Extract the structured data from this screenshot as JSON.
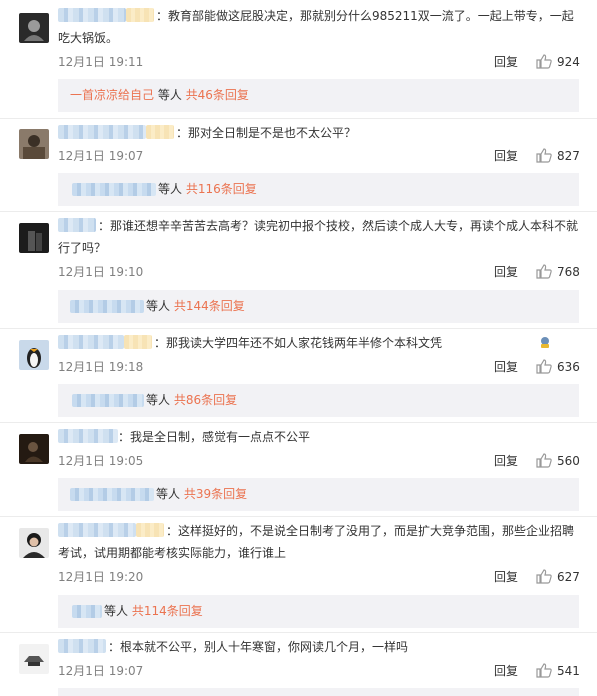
{
  "comments": [
    {
      "text": "：教育部能做这屁股决定，那就别分什么985211双一流了。一起上带专，一起吃大锅饭。",
      "date": "12月1日 19:11",
      "reply_label": "回复",
      "likes": "924",
      "sub_prefix": "一首凉凉给自己",
      "sub_mid": " 等人 ",
      "sub_count": "共46条回复"
    },
    {
      "text": "：那对全日制是不是也不太公平？",
      "date": "12月1日 19:07",
      "reply_label": "回复",
      "likes": "827",
      "sub_mid": "等人 ",
      "sub_count": "共116条回复"
    },
    {
      "text": "：那谁还想辛辛苦苦去高考？读完初中报个技校，然后读个成人大专，再读个成人本科不就行了吗？",
      "date": "12月1日 19:10",
      "reply_label": "回复",
      "likes": "768",
      "sub_mid": "等人 ",
      "sub_count": "共144条回复"
    },
    {
      "text": "：那我读大学四年还不如人家花钱两年半修个本科文凭",
      "date": "12月1日 19:18",
      "reply_label": "回复",
      "likes": "636",
      "sub_mid": "等人 ",
      "sub_count": "共86条回复"
    },
    {
      "text": "：我是全日制，感觉有一点点不公平",
      "date": "12月1日 19:05",
      "reply_label": "回复",
      "likes": "560",
      "sub_mid": "等人 ",
      "sub_count": "共39条回复"
    },
    {
      "text": "：这样挺好的，不是说全日制考了没用了，而是扩大竞争范围，那些企业招聘考试，试用期都能考核实际能力，谁行谁上",
      "date": "12月1日 19:20",
      "reply_label": "回复",
      "likes": "627",
      "sub_mid": "等人 ",
      "sub_count": "共114条回复"
    },
    {
      "text": "：根本就不公平，别人十年寒窗，你网读几个月，一样吗",
      "date": "12月1日 19:07",
      "reply_label": "回复",
      "likes": "541"
    }
  ],
  "colors": {
    "link": "#eb7350",
    "meta": "#808080",
    "sub_bg": "#f2f2f5",
    "sub_link_blue": "#eb7350"
  },
  "icons": [
    "avatar",
    "thumb-up-icon",
    "emoji-icon"
  ]
}
